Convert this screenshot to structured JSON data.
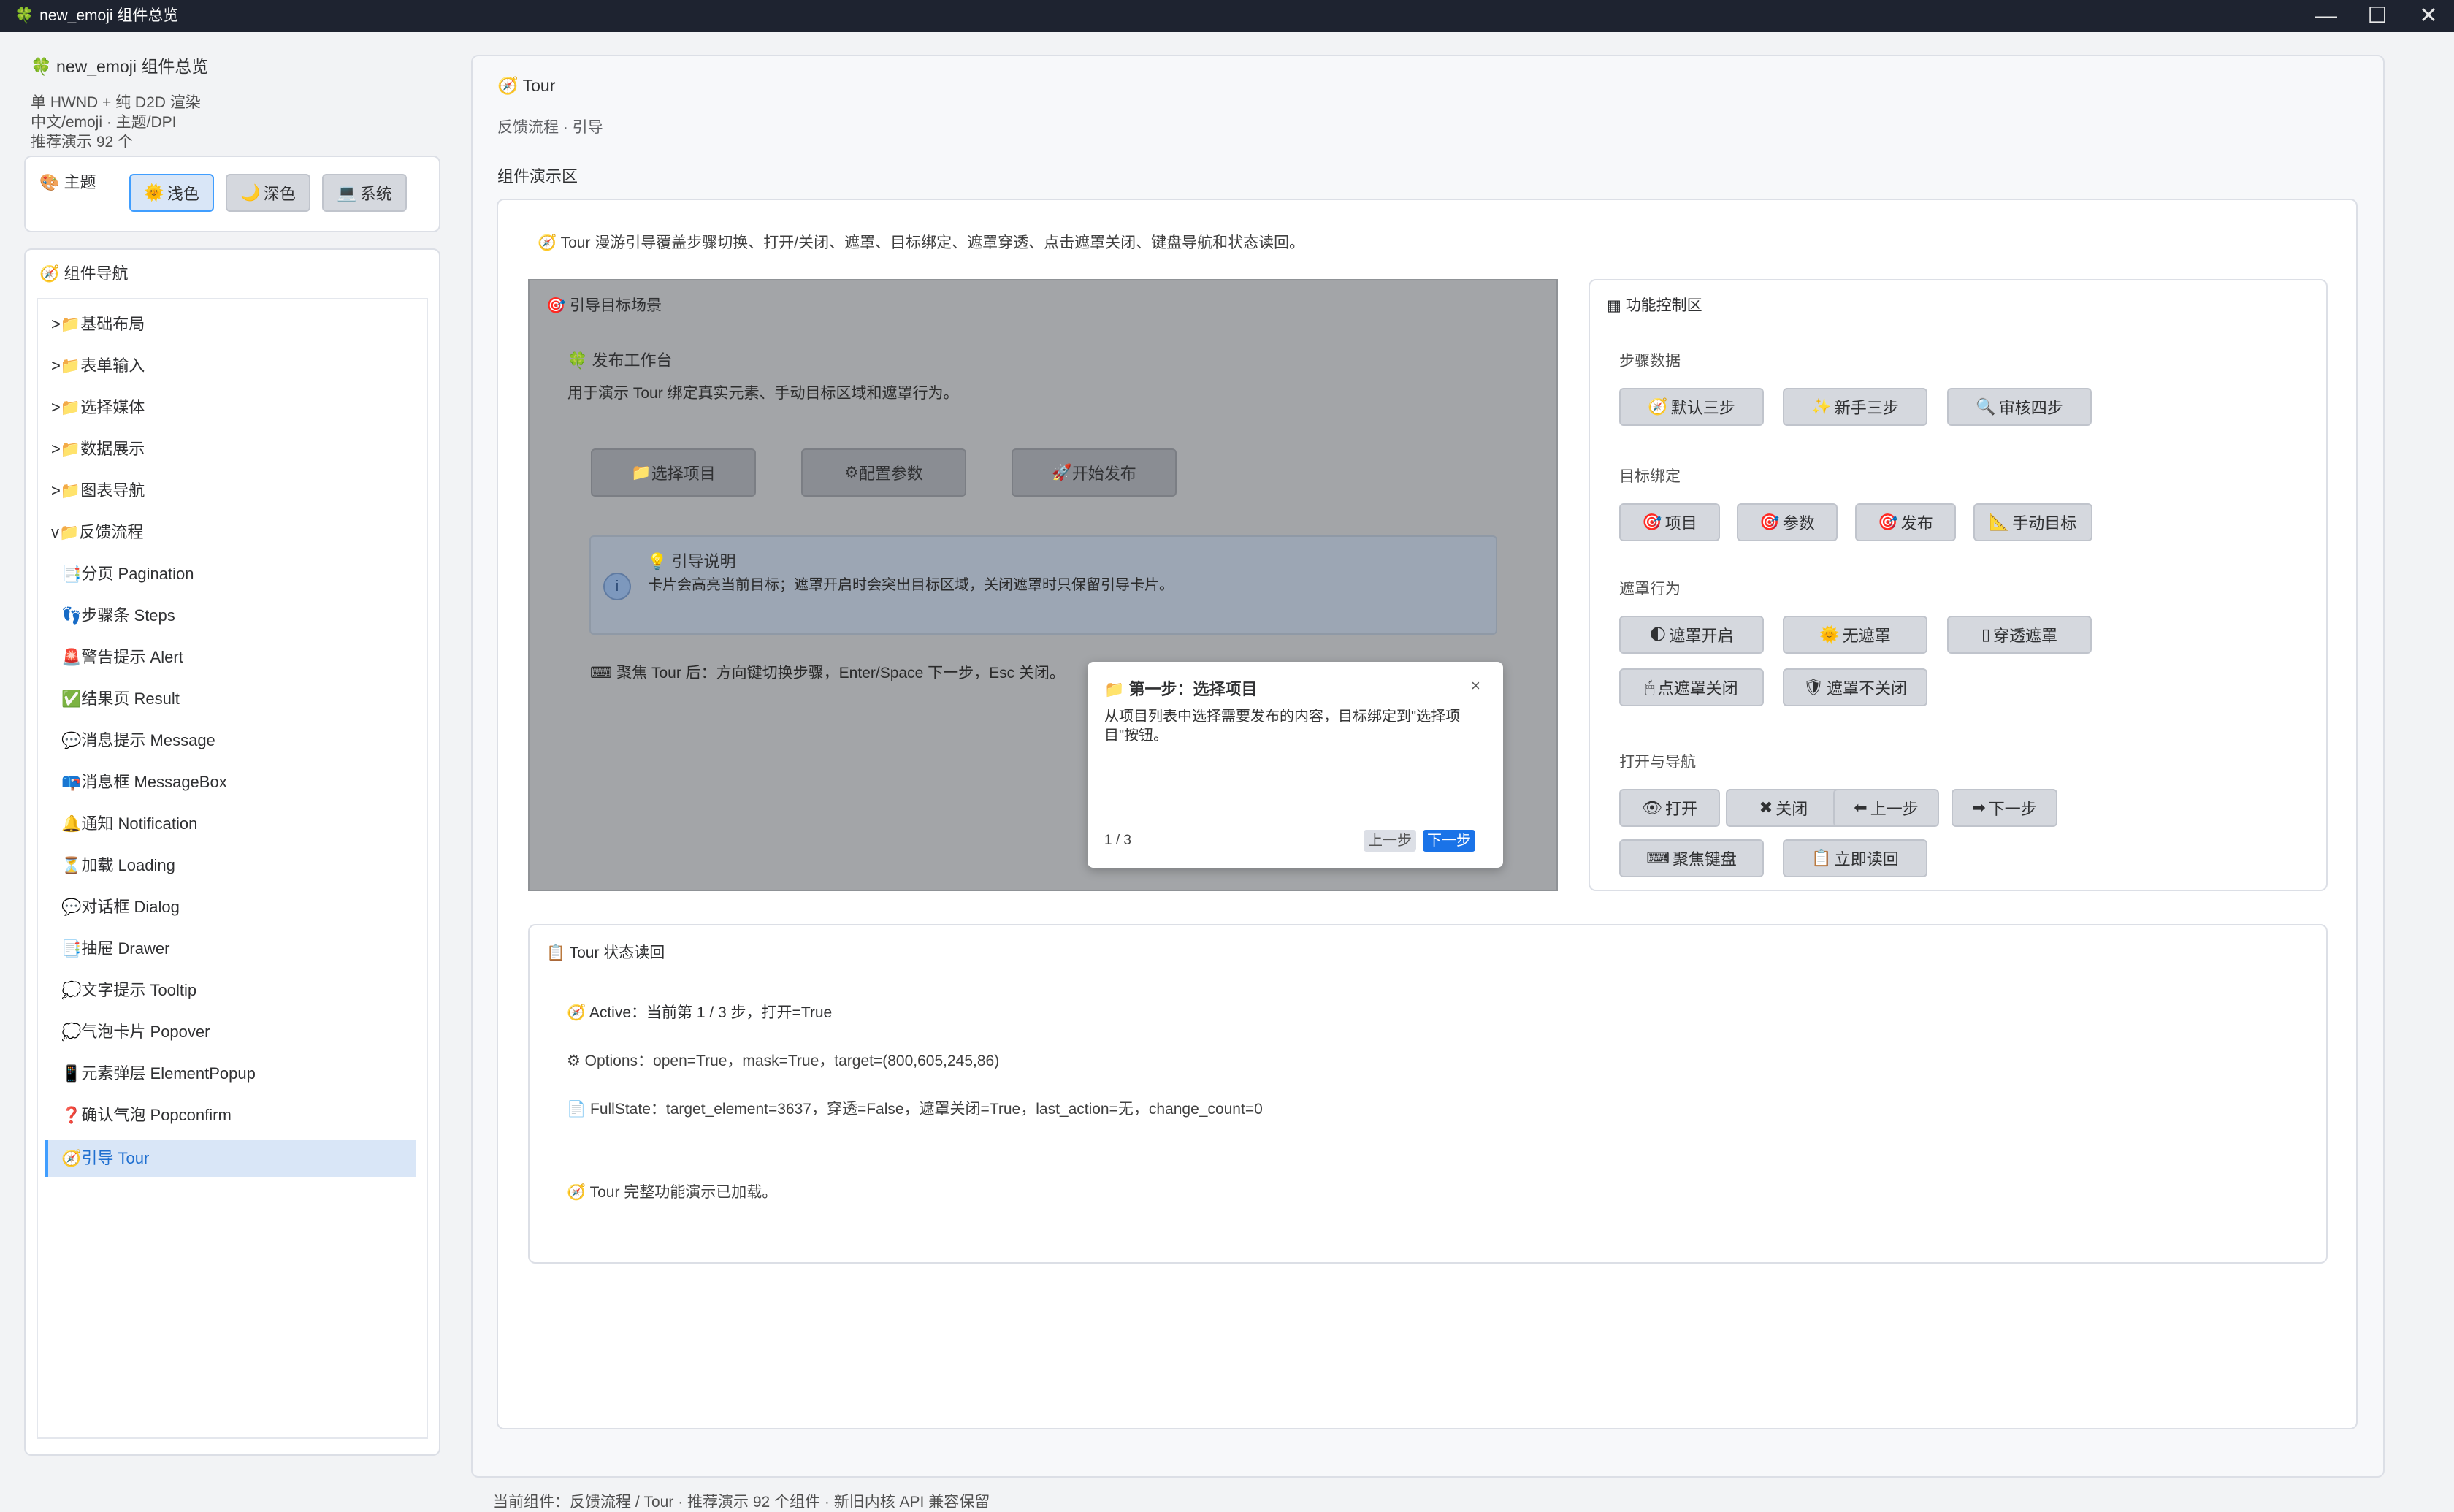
{
  "window": {
    "title": "new_emoji 组件总览",
    "title_icon": "🍀"
  },
  "sidebar": {
    "app_title": "new_emoji 组件总览",
    "info_lines": [
      "单 HWND + 纯 D2D 渲染",
      "中文/emoji · 主题/DPI",
      "推荐演示 92 个"
    ],
    "theme": {
      "label": "主题",
      "icon": "🎨",
      "buttons": [
        {
          "icon": "🌞",
          "label": "浅色",
          "active": true
        },
        {
          "icon": "🌙",
          "label": "深色",
          "active": false
        },
        {
          "icon": "💻",
          "label": "系统",
          "active": false
        }
      ]
    },
    "nav": {
      "title": "组件导航",
      "groups": [
        {
          "label": ">📁基础布局"
        },
        {
          "label": ">📁表单输入"
        },
        {
          "label": ">📁选择媒体"
        },
        {
          "label": ">📁数据展示"
        },
        {
          "label": ">📁图表导航"
        },
        {
          "label": "v📁反馈流程"
        }
      ],
      "children": [
        {
          "icon": "📑",
          "label": "分页 Pagination"
        },
        {
          "icon": "👣",
          "label": "步骤条 Steps"
        },
        {
          "icon": "🚨",
          "label": "警告提示 Alert"
        },
        {
          "icon": "✅",
          "label": "结果页 Result"
        },
        {
          "icon": "💬",
          "label": "消息提示 Message"
        },
        {
          "icon": "📪",
          "label": "消息框 MessageBox"
        },
        {
          "icon": "🔔",
          "label": "通知 Notification"
        },
        {
          "icon": "⏳",
          "label": "加载 Loading"
        },
        {
          "icon": "💬",
          "label": "对话框 Dialog"
        },
        {
          "icon": "📑",
          "label": "抽屉 Drawer"
        },
        {
          "icon": "💭",
          "label": "文字提示 Tooltip"
        },
        {
          "icon": "💭",
          "label": "气泡卡片 Popover"
        },
        {
          "icon": "📱",
          "label": "元素弹层 ElementPopup"
        },
        {
          "icon": "❓",
          "label": "确认气泡 Popconfirm"
        },
        {
          "icon": "🧭",
          "label": "引导 Tour",
          "selected": true
        }
      ]
    }
  },
  "main": {
    "title": "Tour",
    "breadcrumb": "反馈流程 · 引导",
    "demo_area_label": "组件演示区",
    "intro": "Tour 漫游引导覆盖步骤切换、打开/关闭、遮罩、目标绑定、遮罩穿透、点击遮罩关闭、键盘导航和状态读回。",
    "scene": {
      "title": "引导目标场景",
      "workspace_title": "发布工作台",
      "workspace_desc": "用于演示 Tour 绑定真实元素、手动目标区域和遮罩行为。",
      "buttons": [
        {
          "icon": "📁",
          "label": "选择项目"
        },
        {
          "icon": "⚙",
          "label": "配置参数"
        },
        {
          "icon": "🚀",
          "label": "开始发布"
        }
      ],
      "tip_title": "引导说明",
      "tip_body": "卡片会高亮当前目标；遮罩开启时会突出目标区域，关闭遮罩时只保留引导卡片。",
      "keyboard_hint": "聚焦 Tour 后：方向键切换步骤，Enter/Space 下一步，Esc 关闭。"
    },
    "popover": {
      "title": "第一步：选择项目",
      "body": "从项目列表中选择需要发布的内容，目标绑定到\"选择项目\"按钮。",
      "step": "1 / 3",
      "prev": "上一步",
      "next": "下一步",
      "close": "×"
    },
    "controls": {
      "title": "功能控制区",
      "sections": {
        "steps": {
          "label": "步骤数据",
          "buttons": [
            {
              "icon": "🧭",
              "label": "默认三步"
            },
            {
              "icon": "✨",
              "label": "新手三步"
            },
            {
              "icon": "🔍",
              "label": "审核四步"
            }
          ]
        },
        "target": {
          "label": "目标绑定",
          "buttons": [
            {
              "icon": "🎯",
              "label": "项目"
            },
            {
              "icon": "🎯",
              "label": "参数"
            },
            {
              "icon": "🎯",
              "label": "发布"
            },
            {
              "icon": "📐",
              "label": "手动目标"
            }
          ]
        },
        "mask": {
          "label": "遮罩行为",
          "buttons": [
            {
              "icon": "🌓",
              "label": "遮罩开启"
            },
            {
              "icon": "🌞",
              "label": "无遮罩"
            },
            {
              "icon": "▯",
              "label": "穿透遮罩"
            },
            {
              "icon": "🖱",
              "label": "点遮罩关闭"
            },
            {
              "icon": "🛡",
              "label": "遮罩不关闭"
            }
          ]
        },
        "nav": {
          "label": "打开与导航",
          "buttons": [
            {
              "icon": "👁",
              "label": "打开"
            },
            {
              "icon": "✖",
              "label": "关闭"
            },
            {
              "icon": "⬅",
              "label": "上一步"
            },
            {
              "icon": "➡",
              "label": "下一步"
            },
            {
              "icon": "⌨",
              "label": "聚焦键盘"
            },
            {
              "icon": "📋",
              "label": "立即读回"
            }
          ]
        }
      }
    },
    "status": {
      "title": "Tour 状态读回",
      "active": "Active：当前第 1 / 3 步，打开=True",
      "options": "Options：open=True，mask=True，target=(800,605,245,86)",
      "fullstate": "FullState：target_element=3637，穿透=False，遮罩关闭=True，last_action=无，change_count=0",
      "loaded": "Tour 完整功能演示已加载。"
    }
  },
  "footer": {
    "text": "当前组件：反馈流程 / Tour · 推荐演示 92 个组件 · 新旧内核 API 兼容保留"
  },
  "colors": {
    "accent": "#409eff",
    "titlebar": "#1e2330",
    "selected_bg": "#d9e6f7"
  }
}
